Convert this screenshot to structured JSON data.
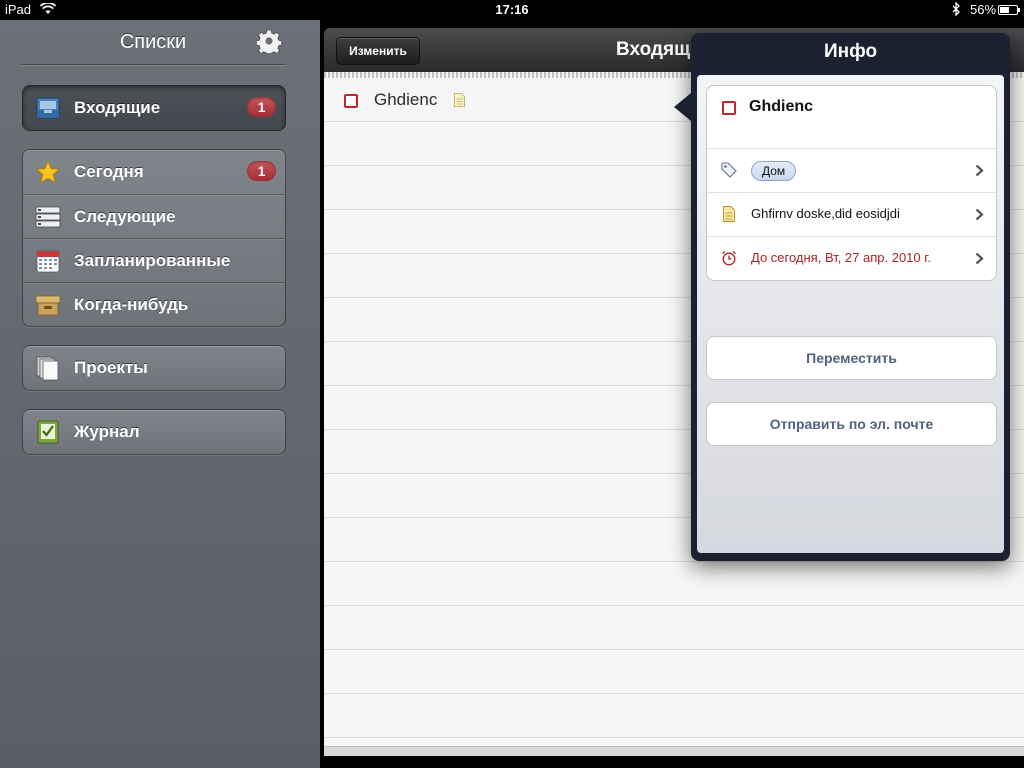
{
  "status_bar": {
    "carrier": "iPad",
    "time": "17:16",
    "battery_percent": "56%",
    "battery_level": 0.56,
    "icons": [
      "wifi-icon",
      "bluetooth-icon",
      "battery-icon"
    ]
  },
  "sidebar": {
    "title": "Списки",
    "settings_icon": "gear-icon",
    "groups": [
      [
        {
          "label": "Входящие",
          "icon": "inbox-icon",
          "badge": "1",
          "selected": true
        }
      ],
      [
        {
          "label": "Сегодня",
          "icon": "star-icon",
          "badge": "1"
        },
        {
          "label": "Следующие",
          "icon": "next-list-icon"
        },
        {
          "label": "Запланированные",
          "icon": "calendar-icon"
        },
        {
          "label": "Когда-нибудь",
          "icon": "archive-box-icon"
        }
      ],
      [
        {
          "label": "Проекты",
          "icon": "projects-icon"
        }
      ],
      [
        {
          "label": "Журнал",
          "icon": "logbook-icon"
        }
      ]
    ]
  },
  "main": {
    "edit_button": "Изменить",
    "title": "Входящие",
    "tasks": [
      {
        "title": "Ghdienc",
        "has_note": true
      }
    ]
  },
  "popover": {
    "title": "Инфо",
    "task_title": "Ghdienc",
    "tag": "Дом",
    "note": "Ghfirnv doske,did eosidjdi",
    "due": "До сегодня, Вт, 27 апр. 2010 г.",
    "move_button": "Переместить",
    "email_button": "Отправить по эл. почте",
    "colors": {
      "due_text": "#b22222",
      "button_text": "#4f6285",
      "badge": "#b0363c"
    }
  }
}
